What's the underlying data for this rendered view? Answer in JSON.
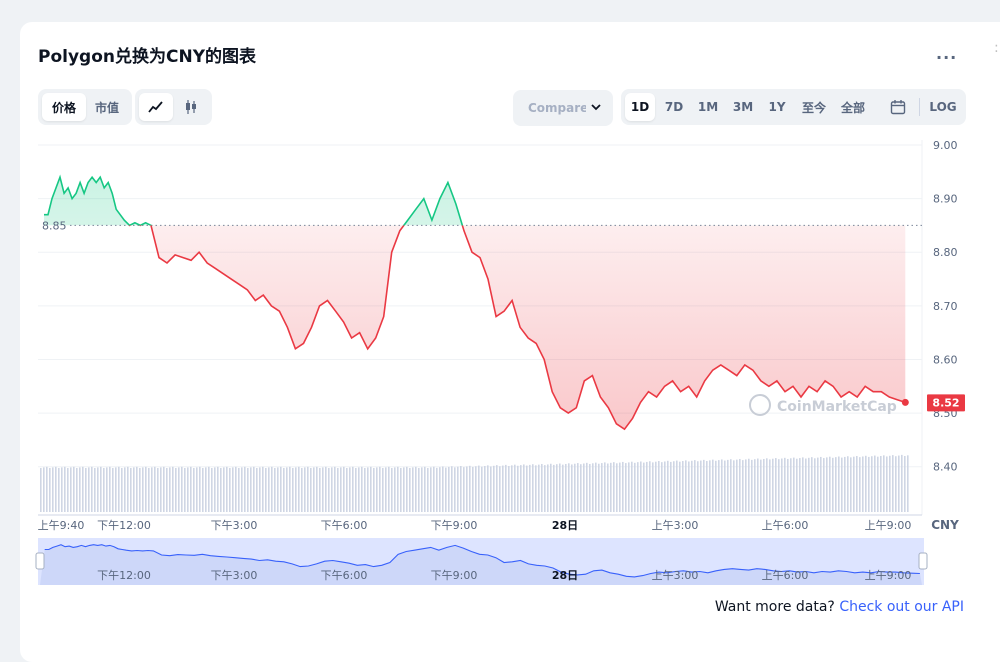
{
  "header": {
    "title": "Polygon兑换为CNY的图表",
    "more_label": "..."
  },
  "controls": {
    "metric_tabs": [
      {
        "label": "价格",
        "active": true
      },
      {
        "label": "市值",
        "active": false
      }
    ],
    "chart_type_icons": [
      "line-chart-icon",
      "candlestick-icon"
    ],
    "compare_label": "Compare w",
    "range_tabs": [
      {
        "label": "1D",
        "active": true
      },
      {
        "label": "7D",
        "active": false
      },
      {
        "label": "1M",
        "active": false
      },
      {
        "label": "3M",
        "active": false
      },
      {
        "label": "1Y",
        "active": false
      },
      {
        "label": "至今",
        "active": false
      },
      {
        "label": "全部",
        "active": false
      }
    ],
    "calendar_icon": "calendar-icon",
    "log_label": "LOG"
  },
  "chart_data": {
    "type": "line",
    "y_ticks": [
      "9.00",
      "8.90",
      "8.80",
      "8.70",
      "8.60",
      "8.50",
      "8.40"
    ],
    "ylim": [
      8.31,
      9.0
    ],
    "x_ticks": [
      "上午9:40",
      "下午12:00",
      "下午3:00",
      "下午6:00",
      "下午9:00",
      "28日",
      "上午3:00",
      "上午6:00",
      "上午9:00"
    ],
    "currency_label": "CNY",
    "baseline_value": 8.85,
    "baseline_label": "8.85",
    "current_value": 8.52,
    "current_label": "8.52",
    "watermark": "CoinMarketCap",
    "colors": {
      "up": "#16c784",
      "down": "#ea3943",
      "volume": "#cfd6e4",
      "navigator": "#dde4ff"
    },
    "series": [
      {
        "name": "",
        "x_hours": [
          0,
          0.15,
          0.3,
          0.45,
          0.6,
          0.75,
          0.9,
          1.05,
          1.2,
          1.35,
          1.5,
          1.65,
          1.8,
          1.95,
          2.1,
          2.25,
          2.4,
          2.55,
          2.7,
          2.85,
          3.0,
          3.2,
          3.4,
          3.6,
          3.8,
          4.0,
          4.3,
          4.6,
          4.9,
          5.2,
          5.5,
          5.8,
          6.1,
          6.4,
          6.7,
          7.0,
          7.3,
          7.6,
          7.9,
          8.2,
          8.5,
          8.8,
          9.1,
          9.4,
          9.7,
          10.0,
          10.3,
          10.6,
          10.9,
          11.2,
          11.5,
          11.8,
          12.1,
          12.4,
          12.7,
          13.0,
          13.3,
          13.6,
          13.9,
          14.2,
          14.5,
          14.8,
          15.1,
          15.4,
          15.7,
          16.0,
          16.3,
          16.6,
          16.9,
          17.2,
          17.5,
          17.8,
          18.1,
          18.4,
          18.7,
          19.0,
          19.3,
          19.6,
          19.9,
          20.2,
          20.5,
          20.8,
          21.1,
          21.4,
          21.7,
          22.0,
          22.3,
          22.6,
          22.9,
          23.2,
          23.5,
          23.8,
          24.1,
          24.4,
          24.7,
          25.0,
          25.3,
          25.6,
          25.9,
          26.2,
          26.5,
          26.8,
          27.1,
          27.4,
          27.7,
          28.0,
          28.3,
          28.6,
          28.9,
          29.2,
          29.5,
          29.8,
          30.1,
          30.4,
          30.7,
          31.0,
          31.3,
          31.6,
          31.9,
          32.2
        ],
        "values": [
          8.87,
          8.87,
          8.9,
          8.92,
          8.94,
          8.91,
          8.92,
          8.9,
          8.91,
          8.93,
          8.91,
          8.93,
          8.94,
          8.93,
          8.94,
          8.92,
          8.93,
          8.91,
          8.88,
          8.87,
          8.86,
          8.85,
          8.855,
          8.85,
          8.855,
          8.85,
          8.79,
          8.78,
          8.795,
          8.79,
          8.785,
          8.8,
          8.78,
          8.77,
          8.76,
          8.75,
          8.74,
          8.73,
          8.71,
          8.72,
          8.7,
          8.69,
          8.66,
          8.62,
          8.63,
          8.66,
          8.7,
          8.71,
          8.69,
          8.67,
          8.64,
          8.65,
          8.62,
          8.64,
          8.68,
          8.8,
          8.84,
          8.86,
          8.88,
          8.9,
          8.86,
          8.9,
          8.93,
          8.89,
          8.84,
          8.8,
          8.79,
          8.75,
          8.68,
          8.69,
          8.71,
          8.66,
          8.64,
          8.63,
          8.6,
          8.54,
          8.51,
          8.5,
          8.51,
          8.56,
          8.57,
          8.53,
          8.51,
          8.48,
          8.47,
          8.49,
          8.52,
          8.54,
          8.53,
          8.55,
          8.56,
          8.54,
          8.55,
          8.53,
          8.56,
          8.58,
          8.59,
          8.58,
          8.57,
          8.59,
          8.58,
          8.56,
          8.55,
          8.56,
          8.54,
          8.55,
          8.53,
          8.55,
          8.54,
          8.56,
          8.55,
          8.53,
          8.54,
          8.53,
          8.55,
          8.54,
          8.54,
          8.53,
          8.525,
          8.52
        ]
      }
    ],
    "xlim_hours": [
      0,
      32.3
    ]
  },
  "footer": {
    "prefix": "Want more data?",
    "link": "Check out our API"
  }
}
